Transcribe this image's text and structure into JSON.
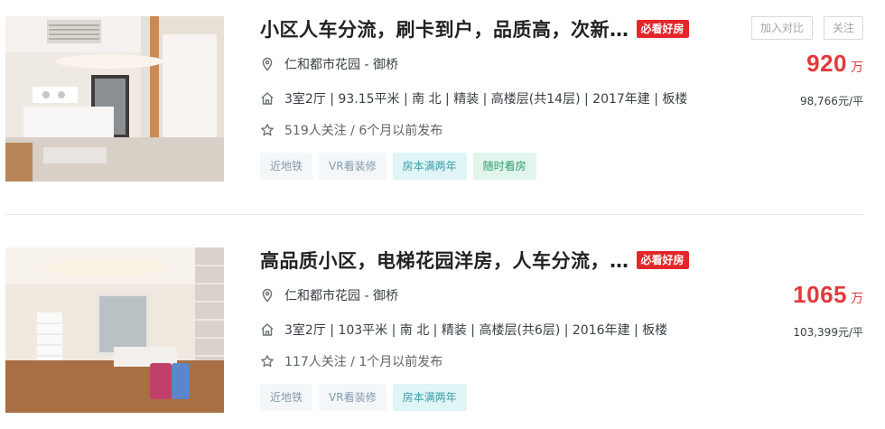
{
  "listings": [
    {
      "title": "小区人车分流，刷卡到户，品质高，次新…",
      "badge": "必看好房",
      "location": "仁和都市花园 - 御桥",
      "house_info": "3室2厅 | 93.15平米 | 南 北 | 精装 | 高楼层(共14层) | 2017年建 | 板楼",
      "follow_info": "519人关注 / 6个月以前发布",
      "tags": [
        {
          "label": "近地铁",
          "style": "gray"
        },
        {
          "label": "VR看装修",
          "style": "gray"
        },
        {
          "label": "房本满两年",
          "style": "teal"
        },
        {
          "label": "随时看房",
          "style": "green"
        }
      ],
      "compare_label": "加入对比",
      "follow_label": "关注",
      "total_price": "920",
      "price_unit": "万",
      "unit_price": "98,766元/平"
    },
    {
      "title": "高品质小区，电梯花园洋房，人车分流，…",
      "badge": "必看好房",
      "location": "仁和都市花园 - 御桥",
      "house_info": "3室2厅 | 103平米 | 南 北 | 精装 | 高楼层(共6层) | 2016年建 | 板楼",
      "follow_info": "117人关注 / 1个月以前发布",
      "tags": [
        {
          "label": "近地铁",
          "style": "gray"
        },
        {
          "label": "VR看装修",
          "style": "gray"
        },
        {
          "label": "房本满两年",
          "style": "teal"
        }
      ],
      "total_price": "1065",
      "price_unit": "万",
      "unit_price": "103,399元/平"
    }
  ],
  "colors": {
    "price": "#e4393c",
    "badge": "#e4262a",
    "tag_teal": "#3f9ba9",
    "tag_green": "#2e9e6b"
  },
  "icons": {
    "location": "location-pin-icon",
    "house": "house-icon",
    "follow": "star-icon"
  }
}
